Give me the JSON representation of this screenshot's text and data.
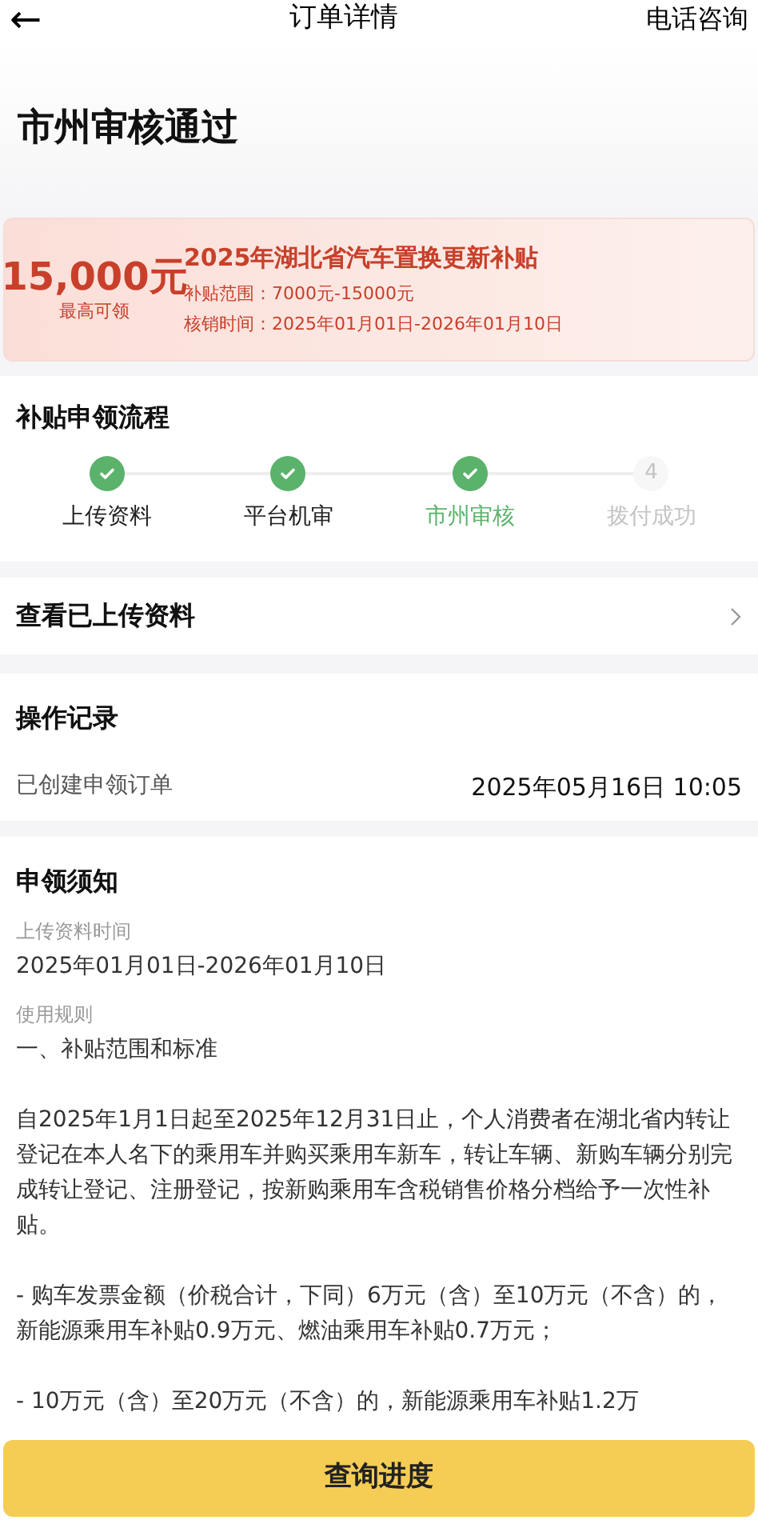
{
  "nav": {
    "back": "←",
    "title": "订单详情",
    "action": "电话咨询"
  },
  "status_title": "市州审核通过",
  "banner": {
    "amount": "15,000元",
    "amount_caption": "最高可领",
    "title": "2025年湖北省汽车置换更新补贴",
    "range": "补贴范围：7000元-15000元",
    "period": "核销时间：2025年01月01日-2026年01月10日"
  },
  "process": {
    "title": "补贴申领流程",
    "steps": [
      {
        "label": "上传资料",
        "done": true,
        "selected": false
      },
      {
        "label": "平台机审",
        "done": true,
        "selected": false
      },
      {
        "label": "市州审核",
        "done": true,
        "selected": true
      },
      {
        "label": "拨付成功",
        "done": false,
        "number": "4",
        "selected": false
      }
    ]
  },
  "uploaded_link": {
    "label": "查看已上传资料"
  },
  "records": {
    "title": "操作记录",
    "items": [
      {
        "event": "已创建申领订单",
        "time": "2025年05月16日 10:05"
      }
    ]
  },
  "notice": {
    "title": "申领须知",
    "sections": [
      {
        "label": "上传资料时间",
        "paragraphs": [
          "2025年01月01日-2026年01月10日"
        ]
      },
      {
        "label": "使用规则",
        "paragraphs": [
          "一、补贴范围和标准",
          "自2025年1月1日起至2025年12月31日止，个人消费者在湖北省内转让登记在本人名下的乘用车并购买乘用车新车，转让车辆、新购车辆分别完成转让登记、注册登记，按新购乘用车含税销售价格分档给予一次性补贴。",
          "- 购车发票金额（价税合计，下同）6万元（含）至10万元（不含）的，新能源乘用车补贴0.9万元、燃油乘用车补贴0.7万元；",
          "- 10万元（含）至20万元（不含）的，新能源乘用车补贴1.2万"
        ]
      }
    ]
  },
  "primary_button": "查询进度"
}
